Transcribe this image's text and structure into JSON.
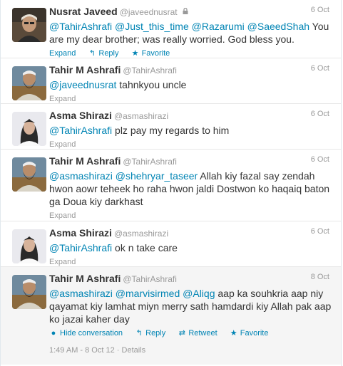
{
  "tweets": [
    {
      "fullname": "Nusrat Javeed",
      "username": "@javeednusrat",
      "protected": true,
      "time": "6 Oct",
      "parts": [
        {
          "t": "@TahirAshrafi",
          "m": true
        },
        {
          "t": " "
        },
        {
          "t": "@Just_this_time",
          "m": true
        },
        {
          "t": " "
        },
        {
          "t": "@Razarumi",
          "m": true
        },
        {
          "t": " "
        },
        {
          "t": "@SaeedShah",
          "m": true
        },
        {
          "t": " You are my dear brother; was really worried. God bless you."
        }
      ],
      "actions": [
        "Expand",
        "Reply",
        "Favorite"
      ],
      "avatar": "older-man"
    },
    {
      "fullname": "Tahir M Ashrafi",
      "username": "@TahirAshrafi",
      "time": "6 Oct",
      "parts": [
        {
          "t": "@javeednusrat",
          "m": true
        },
        {
          "t": " tahnkyou uncle"
        }
      ],
      "actions": [
        "Expand"
      ],
      "avatar": "bearded-man"
    },
    {
      "fullname": "Asma Shirazi",
      "username": "@asmashirazi",
      "time": "6 Oct",
      "parts": [
        {
          "t": "@TahirAshrafi",
          "m": true
        },
        {
          "t": " plz pay my regards to him"
        }
      ],
      "actions": [
        "Expand"
      ],
      "avatar": "woman"
    },
    {
      "fullname": "Tahir M Ashrafi",
      "username": "@TahirAshrafi",
      "time": "6 Oct",
      "parts": [
        {
          "t": "@asmashirazi",
          "m": true
        },
        {
          "t": " "
        },
        {
          "t": "@shehryar_taseer",
          "m": true
        },
        {
          "t": " Allah kiy fazal say zendah hwon aowr teheek ho raha hwon jaldi Dostwon ko haqaiq baton ga Doua kiy darkhast"
        }
      ],
      "actions": [
        "Expand"
      ],
      "avatar": "bearded-man"
    },
    {
      "fullname": "Asma Shirazi",
      "username": "@asmashirazi",
      "time": "6 Oct",
      "parts": [
        {
          "t": "@TahirAshrafi",
          "m": true
        },
        {
          "t": " ok n take care"
        }
      ],
      "actions": [
        "Expand"
      ],
      "avatar": "woman"
    },
    {
      "fullname": "Tahir M Ashrafi",
      "username": "@TahirAshrafi",
      "time": "8 Oct",
      "parts": [
        {
          "t": "@asmashirazi",
          "m": true
        },
        {
          "t": " "
        },
        {
          "t": "@marvisirmed",
          "m": true
        },
        {
          "t": " "
        },
        {
          "t": "@Aliqg",
          "m": true
        },
        {
          "t": " aap ka souhkria aap niy qayamat kiy lamhat miyn merry sath hamdardi kiy Allah pak aap ko jazai kaher day"
        }
      ],
      "actions": [
        "Hide conversation",
        "Reply",
        "Retweet",
        "Favorite"
      ],
      "avatar": "bearded-man",
      "expanded": true,
      "meta": {
        "timestamp": "1:49 AM - 8 Oct 12",
        "sep": "·",
        "details": "Details"
      }
    }
  ],
  "colors": {
    "link": "#0084b4",
    "muted": "#999999",
    "text": "#333333"
  }
}
